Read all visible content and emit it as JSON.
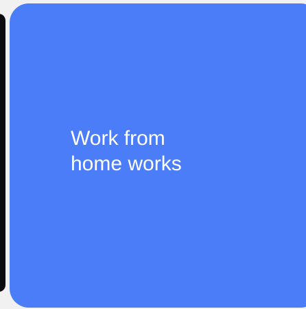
{
  "card": {
    "text": "Work from home works",
    "background_color": "#4a7df7",
    "text_color": "#ffffff"
  },
  "page": {
    "background_color": "#f1f1f2",
    "adjacent_card_color": "#0c0c10"
  }
}
